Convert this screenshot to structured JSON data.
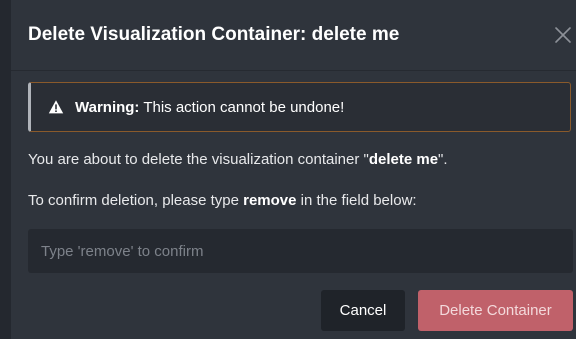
{
  "dialog": {
    "title": "Delete Visualization Container: delete me",
    "close_icon": "close-icon"
  },
  "warning": {
    "icon": "warning-triangle-icon",
    "label": "Warning:",
    "message": " This action cannot be undone!",
    "accent_color": "#8a5a2b"
  },
  "body": {
    "intro_prefix": "You are about to delete the visualization container \"",
    "container_name": "delete me",
    "intro_suffix": "\".",
    "confirm_prefix": "To confirm deletion, please type ",
    "confirm_keyword": "remove",
    "confirm_suffix": " in the field below:"
  },
  "input": {
    "value": "",
    "placeholder": "Type 'remove' to confirm"
  },
  "buttons": {
    "cancel_label": "Cancel",
    "delete_label": "Delete Container",
    "delete_color": "#c0616a"
  }
}
